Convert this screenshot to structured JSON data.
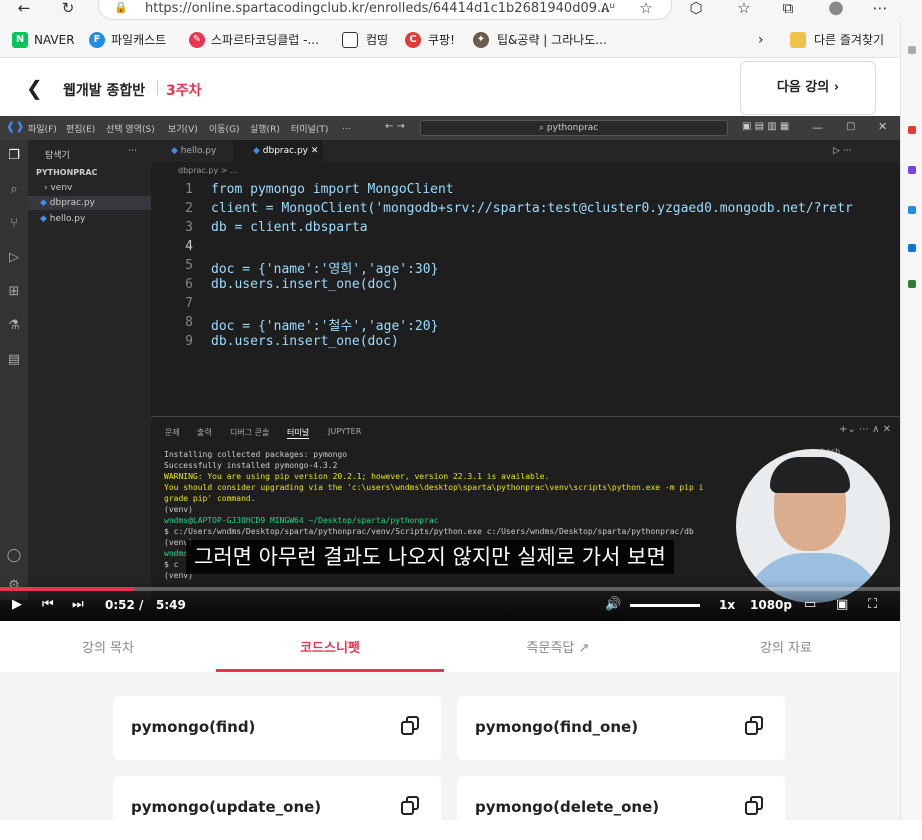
{
  "browser": {
    "url": "https://online.spartacodingclub.kr/enrolleds/64414d1c1b2681940d09...",
    "read_aloud": "Aᵁ"
  },
  "bookmarks": {
    "items": [
      "NAVER",
      "파일캐스트",
      "스파르타코딩클럽 -...",
      "컴띵",
      "쿠팡!",
      "팁&공략 | 그라나도..."
    ],
    "other": "다른 즐겨찾기"
  },
  "header": {
    "course": "웹개발 종합반",
    "week": "3주차",
    "next_label": "다음 강의"
  },
  "vscode": {
    "menus": [
      "파일(F)",
      "편집(E)",
      "선택 영역(S)",
      "보기(V)",
      "이동(G)",
      "실행(R)",
      "터미널(T)",
      "..."
    ],
    "search": "pythonprac",
    "explorer_title": "탐색기",
    "project": "PYTHONPRAC",
    "files": [
      "venv",
      "dbprac.py",
      "hello.py"
    ],
    "tabs": [
      "hello.py",
      "dbprac.py"
    ],
    "breadcrumb": "dbprac.py > ...",
    "code_lines": [
      {
        "n": "1",
        "t": "from pymongo import MongoClient"
      },
      {
        "n": "2",
        "t": "client = MongoClient('mongodb+srv://sparta:test@cluster0.yzgaed0.mongodb.net/?retr"
      },
      {
        "n": "3",
        "t": "db = client.dbsparta"
      },
      {
        "n": "4",
        "t": ""
      },
      {
        "n": "5",
        "t": "doc = {'name':'영희','age':30}"
      },
      {
        "n": "6",
        "t": "db.users.insert_one(doc)"
      },
      {
        "n": "7",
        "t": ""
      },
      {
        "n": "8",
        "t": "doc = {'name':'철수','age':20}"
      },
      {
        "n": "9",
        "t": "db.users.insert_one(doc)"
      }
    ],
    "panel_tabs": [
      "문제",
      "출력",
      "디버그 콘솔",
      "터미널",
      "JUPYTER"
    ],
    "terminal_lines": [
      "Installing collected packages: pymongo",
      "Successfully installed pymongo-4.3.2",
      "WARNING: You are using pip version 20.2.1; however, version 22.3.1 is available.",
      "You should consider upgrading via the 'c:\\users\\wndms\\desktop\\sparta\\pythonprac\\venv\\scripts\\python.exe -m pip i",
      "grade pip' command.",
      "(venv)",
      "wndms@LAPTOP-GJ30HCD9 MINGW64 ~/Desktop/sparta/pythonprac",
      "$ c:/Users/wndms/Desktop/sparta/pythonprac/venv/Scripts/python.exe c:/Users/wndms/Desktop/sparta/pythonprac/db",
      "(venv)",
      "wndms",
      "$ c",
      "(venv)"
    ],
    "terminal_shell": "bash"
  },
  "video": {
    "subtitle": "그러면 아무런 결과도 나오지 않지만 실제로 가서 보면",
    "current": "0:52",
    "slash": "/",
    "duration": "5:49",
    "progress": 0.149,
    "speed": "1x",
    "quality": "1080p"
  },
  "lecture_tabs": [
    "강의 목차",
    "코드스니펫",
    "즉문즉답",
    "강의 자료"
  ],
  "snippets": [
    "pymongo(find)",
    "pymongo(find_one)",
    "pymongo(update_one)",
    "pymongo(delete_one)"
  ],
  "colors": {
    "accent": "#e8344e"
  }
}
